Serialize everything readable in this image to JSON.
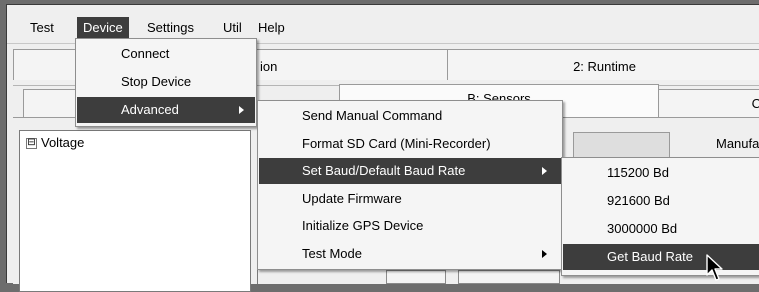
{
  "menubar": {
    "items": [
      "Test",
      "Device",
      "Settings",
      "Util",
      "Help"
    ],
    "active_index": 1
  },
  "tabs_row1": {
    "partial_label": "ion",
    "runtime_label": "2: Runtime"
  },
  "tabs_row2": {
    "sensors_label": "B: Sensors",
    "partial_label": "C"
  },
  "tree": {
    "node_label": "Voltage",
    "expander": "⊟"
  },
  "right_panel": {
    "manufacturer_partial": "Manufa"
  },
  "device_menu": {
    "items": [
      "Connect",
      "Stop Device",
      "Advanced"
    ],
    "highlighted": "Advanced"
  },
  "advanced_menu": {
    "items": [
      "Send Manual Command",
      "Format SD Card (Mini-Recorder)",
      "Set Baud/Default Baud Rate",
      "Update Firmware",
      "Initialize GPS Device",
      "Test Mode"
    ],
    "highlighted": "Set Baud/Default Baud Rate"
  },
  "baud_menu": {
    "items": [
      "115200 Bd",
      "921600 Bd",
      "3000000 Bd",
      "Get Baud Rate"
    ],
    "highlighted": "Get Baud Rate"
  },
  "colors": {
    "highlight_bg": "#3d3d3d",
    "menu_bg": "#f5f5f5",
    "window_bg": "#efefef"
  }
}
